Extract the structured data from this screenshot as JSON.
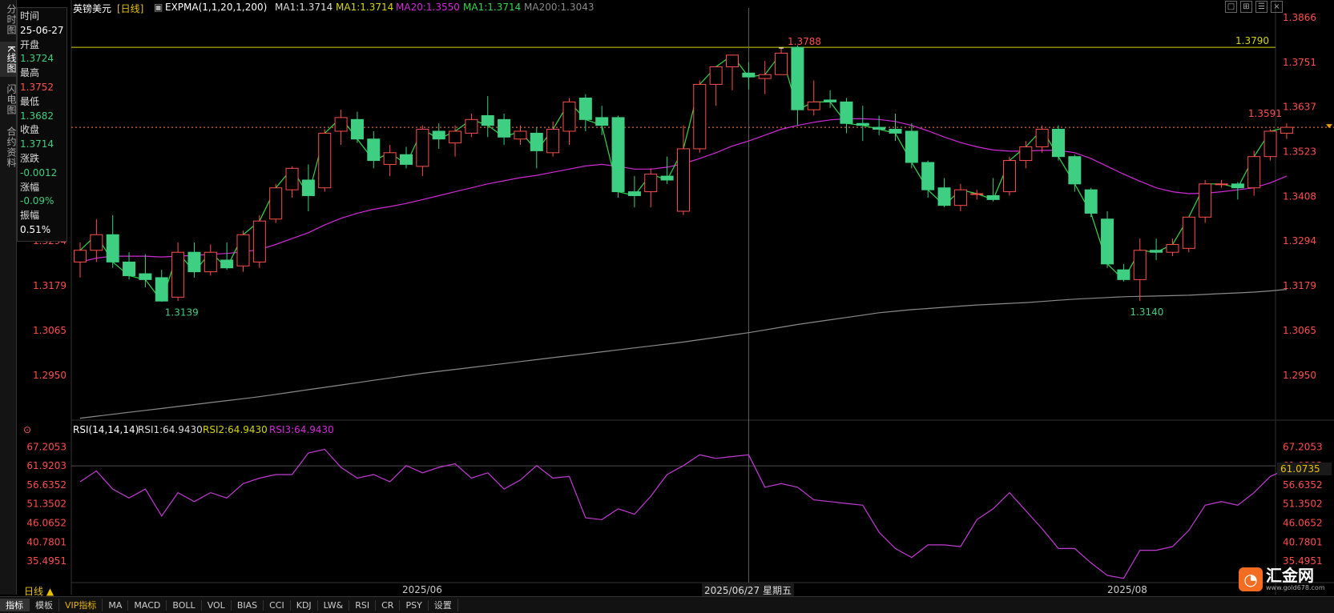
{
  "sidebar": {
    "tabs": [
      "分时图",
      "K线图",
      "闪电图",
      "合约资料"
    ],
    "active": 1
  },
  "info_panel": {
    "time_label": "时间",
    "time_value": "25-06-27",
    "open_label": "开盘",
    "open_value": "1.3724",
    "high_label": "最高",
    "high_value": "1.3752",
    "low_label": "最低",
    "low_value": "1.3682",
    "close_label": "收盘",
    "close_value": "1.3714",
    "change_label": "涨跌",
    "change_value": "-0.0012",
    "pct_label": "涨幅",
    "pct_value": "-0.09%",
    "amp_label": "振幅",
    "amp_value": "0.51%"
  },
  "header": {
    "symbol": "英镑美元",
    "period": "[日线]",
    "indicator": "EXPMA(1,1,20,1,200)",
    "ma1": "MA1:1.3714",
    "ma1b": "MA1:1.3714",
    "ma20": "MA20:1.3550",
    "ma1c": "MA1:1.3714",
    "ma200": "MA200:1.3043"
  },
  "rsi_header": {
    "name": "RSI(14,14,14)",
    "rsi1": "RSI1:64.9430",
    "rsi2": "RSI2:64.9430",
    "rsi3": "RSI3:64.9430"
  },
  "price_axis": [
    "1.3866",
    "1.3751",
    "1.3637",
    "1.3523",
    "1.3408",
    "1.3294",
    "1.3179",
    "1.3065",
    "1.2950"
  ],
  "rsi_axis": [
    "67.2053",
    "61.9203",
    "56.6352",
    "51.3502",
    "46.0652",
    "40.7801",
    "35.4951"
  ],
  "rsi_current": "61.0735",
  "annotations": {
    "high": "1.3788",
    "low1": "1.3139",
    "low2": "1.3140",
    "last_high": "1.3591",
    "resistance": "1.3790"
  },
  "date_axis": [
    "2025/06",
    "2025/08"
  ],
  "crosshair_date": "2025/06/27 星期五",
  "bottom": {
    "period_button": "日线 ▲",
    "tabs": [
      "指标",
      "模板",
      "VIP指标",
      "MA",
      "MACD",
      "BOLL",
      "VOL",
      "BIAS",
      "CCI",
      "KDJ",
      "LW&",
      "RSI",
      "CR",
      "PSY",
      "设置"
    ]
  },
  "logo": {
    "name": "汇金网",
    "url": "www.gold678.com"
  },
  "colors": {
    "up": "#ff4d4d",
    "down": "#3ecf82",
    "ma20": "#d12ad8",
    "ma200": "#8a8a8a",
    "ma1": "#2fd84a",
    "resistance": "#d6d600",
    "rsi": "#c23bd4"
  },
  "chart_data": {
    "type": "candlestick",
    "title": "英镑美元 [日线]",
    "ylim": [
      1.2835,
      1.3866
    ],
    "resistance": 1.379,
    "ohlc": [
      [
        1.324,
        1.329,
        1.32,
        1.327
      ],
      [
        1.327,
        1.335,
        1.324,
        1.331
      ],
      [
        1.331,
        1.336,
        1.3225,
        1.324
      ],
      [
        1.324,
        1.3265,
        1.3195,
        1.3205
      ],
      [
        1.321,
        1.326,
        1.3175,
        1.3195
      ],
      [
        1.32,
        1.322,
        1.3139,
        1.314
      ],
      [
        1.315,
        1.329,
        1.314,
        1.3265
      ],
      [
        1.3265,
        1.329,
        1.32,
        1.3215
      ],
      [
        1.3215,
        1.3285,
        1.3205,
        1.3265
      ],
      [
        1.3245,
        1.329,
        1.322,
        1.3225
      ],
      [
        1.323,
        1.332,
        1.3215,
        1.331
      ],
      [
        1.324,
        1.336,
        1.3225,
        1.3345
      ],
      [
        1.335,
        1.344,
        1.334,
        1.343
      ],
      [
        1.3425,
        1.3485,
        1.3405,
        1.348
      ],
      [
        1.345,
        1.349,
        1.337,
        1.341
      ],
      [
        1.343,
        1.358,
        1.342,
        1.357
      ],
      [
        1.3575,
        1.363,
        1.354,
        1.361
      ],
      [
        1.3605,
        1.3625,
        1.3545,
        1.3555
      ],
      [
        1.3555,
        1.3575,
        1.348,
        1.35
      ],
      [
        1.349,
        1.354,
        1.346,
        1.352
      ],
      [
        1.3515,
        1.3535,
        1.348,
        1.349
      ],
      [
        1.3485,
        1.359,
        1.346,
        1.358
      ],
      [
        1.3575,
        1.3595,
        1.353,
        1.3555
      ],
      [
        1.3545,
        1.359,
        1.351,
        1.3575
      ],
      [
        1.357,
        1.362,
        1.356,
        1.3605
      ],
      [
        1.3615,
        1.3665,
        1.356,
        1.359
      ],
      [
        1.3605,
        1.362,
        1.354,
        1.356
      ],
      [
        1.3555,
        1.359,
        1.354,
        1.3575
      ],
      [
        1.357,
        1.3585,
        1.348,
        1.3525
      ],
      [
        1.352,
        1.36,
        1.351,
        1.358
      ],
      [
        1.3575,
        1.366,
        1.354,
        1.365
      ],
      [
        1.366,
        1.367,
        1.3575,
        1.3605
      ],
      [
        1.361,
        1.364,
        1.3565,
        1.359
      ],
      [
        1.361,
        1.3615,
        1.3405,
        1.342
      ],
      [
        1.342,
        1.346,
        1.338,
        1.341
      ],
      [
        1.342,
        1.348,
        1.338,
        1.3465
      ],
      [
        1.346,
        1.351,
        1.344,
        1.345
      ],
      [
        1.337,
        1.359,
        1.336,
        1.353
      ],
      [
        1.353,
        1.3705,
        1.352,
        1.3695
      ],
      [
        1.3695,
        1.374,
        1.364,
        1.374
      ],
      [
        1.374,
        1.377,
        1.368,
        1.377
      ],
      [
        1.3724,
        1.3752,
        1.3682,
        1.3714
      ],
      [
        1.371,
        1.3755,
        1.367,
        1.372
      ],
      [
        1.372,
        1.3788,
        1.372,
        1.3775
      ],
      [
        1.379,
        1.3795,
        1.359,
        1.363
      ],
      [
        1.363,
        1.3705,
        1.3615,
        1.365
      ],
      [
        1.3655,
        1.368,
        1.3635,
        1.365
      ],
      [
        1.365,
        1.366,
        1.357,
        1.3595
      ],
      [
        1.3595,
        1.364,
        1.355,
        1.359
      ],
      [
        1.3585,
        1.3615,
        1.3565,
        1.358
      ],
      [
        1.358,
        1.362,
        1.355,
        1.357
      ],
      [
        1.3575,
        1.3595,
        1.348,
        1.3495
      ],
      [
        1.3495,
        1.35,
        1.3405,
        1.3425
      ],
      [
        1.343,
        1.3455,
        1.338,
        1.3385
      ],
      [
        1.3385,
        1.344,
        1.337,
        1.3425
      ],
      [
        1.3415,
        1.3425,
        1.34,
        1.3415
      ],
      [
        1.341,
        1.3455,
        1.3395,
        1.34
      ],
      [
        1.342,
        1.351,
        1.341,
        1.35
      ],
      [
        1.35,
        1.355,
        1.348,
        1.3535
      ],
      [
        1.3535,
        1.359,
        1.352,
        1.358
      ],
      [
        1.358,
        1.359,
        1.35,
        1.351
      ],
      [
        1.351,
        1.3515,
        1.342,
        1.344
      ],
      [
        1.3425,
        1.343,
        1.3355,
        1.3365
      ],
      [
        1.335,
        1.337,
        1.3225,
        1.3235
      ],
      [
        1.322,
        1.3235,
        1.319,
        1.3195
      ],
      [
        1.3195,
        1.33,
        1.314,
        1.327
      ],
      [
        1.327,
        1.33,
        1.3245,
        1.3265
      ],
      [
        1.3265,
        1.33,
        1.3255,
        1.3285
      ],
      [
        1.3275,
        1.334,
        1.3265,
        1.3355
      ],
      [
        1.3355,
        1.345,
        1.334,
        1.344
      ],
      [
        1.344,
        1.345,
        1.343,
        1.344
      ],
      [
        1.344,
        1.3445,
        1.34,
        1.343
      ],
      [
        1.343,
        1.3525,
        1.341,
        1.351
      ],
      [
        1.351,
        1.358,
        1.35,
        1.3575
      ],
      [
        1.357,
        1.3595,
        1.3555,
        1.3585
      ]
    ],
    "ma20": [
      1.324,
      1.325,
      1.3255,
      1.3255,
      1.3255,
      1.3253,
      1.3255,
      1.3257,
      1.326,
      1.3262,
      1.3266,
      1.3272,
      1.3285,
      1.33,
      1.3315,
      1.3335,
      1.3352,
      1.3365,
      1.3375,
      1.3382,
      1.339,
      1.34,
      1.341,
      1.342,
      1.343,
      1.344,
      1.3448,
      1.3456,
      1.3462,
      1.347,
      1.3478,
      1.3486,
      1.349,
      1.3485,
      1.3478,
      1.3478,
      1.3483,
      1.3492,
      1.3505,
      1.352,
      1.3537,
      1.355,
      1.3565,
      1.358,
      1.359,
      1.3598,
      1.3604,
      1.3607,
      1.3607,
      1.3605,
      1.36,
      1.359,
      1.3576,
      1.356,
      1.3546,
      1.3535,
      1.3527,
      1.3524,
      1.3524,
      1.3526,
      1.3526,
      1.352,
      1.3505,
      1.3485,
      1.3465,
      1.3447,
      1.343,
      1.342,
      1.3415,
      1.3416,
      1.342,
      1.3425,
      1.343,
      1.3443,
      1.346
    ],
    "ma200": [
      1.284,
      1.2845,
      1.285,
      1.2855,
      1.286,
      1.2865,
      1.287,
      1.2875,
      1.288,
      1.2885,
      1.289,
      1.2895,
      1.2901,
      1.2907,
      1.2913,
      1.2919,
      1.2925,
      1.2931,
      1.2937,
      1.2943,
      1.2949,
      1.2955,
      1.296,
      1.2965,
      1.297,
      1.2975,
      1.298,
      1.2985,
      1.299,
      1.2995,
      1.3,
      1.3005,
      1.301,
      1.3015,
      1.302,
      1.3025,
      1.303,
      1.3035,
      1.3041,
      1.3047,
      1.3053,
      1.3059,
      1.3066,
      1.3073,
      1.308,
      1.3086,
      1.3092,
      1.3098,
      1.3104,
      1.311,
      1.3114,
      1.3118,
      1.3121,
      1.3124,
      1.3127,
      1.313,
      1.3132,
      1.3134,
      1.3136,
      1.3139,
      1.3142,
      1.3145,
      1.3147,
      1.3149,
      1.3151,
      1.3152,
      1.3153,
      1.3154,
      1.3155,
      1.3157,
      1.3159,
      1.3161,
      1.3163,
      1.3166,
      1.317
    ],
    "rsi": {
      "ylim": [
        30.2,
        69.5
      ],
      "values": [
        57.5,
        60.5,
        55.5,
        53.0,
        55.5,
        48.0,
        54.5,
        52.0,
        54.5,
        53.0,
        57.0,
        58.5,
        59.5,
        59.5,
        65.5,
        66.5,
        61.5,
        58.5,
        59.5,
        57.5,
        62.0,
        60.0,
        61.5,
        62.5,
        58.5,
        60.0,
        55.5,
        58.0,
        62.0,
        58.5,
        59.0,
        47.5,
        47.0,
        50.0,
        48.5,
        53.5,
        59.5,
        62.0,
        65.0,
        64.0,
        64.5,
        65.0,
        56.0,
        57.0,
        56.0,
        52.5,
        52.0,
        51.5,
        51.0,
        43.5,
        39.0,
        36.5,
        40.0,
        40.0,
        39.5,
        47.0,
        50.0,
        54.5,
        49.5,
        44.5,
        39.0,
        39.0,
        35.0,
        31.5,
        30.7,
        38.5,
        38.5,
        39.5,
        44.0,
        51.0,
        52.0,
        51.0,
        54.5,
        59.0,
        61.0
      ]
    }
  }
}
